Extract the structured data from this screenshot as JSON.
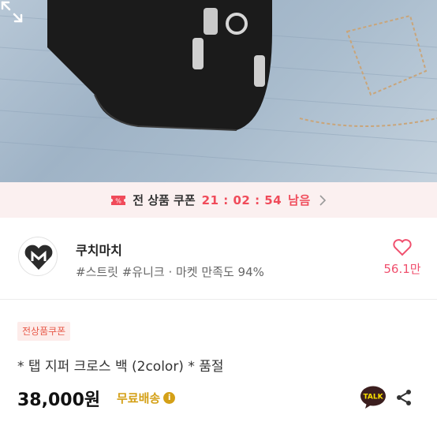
{
  "product_image": {
    "alt": "black crossbody bag on denim",
    "expand_icon": "expand-icon"
  },
  "coupon_banner": {
    "icon": "coupon-icon",
    "label": "전 상품 쿠폰",
    "timer": "21 : 02 : 54",
    "suffix": "남음",
    "arrow_icon": "chevron-right-icon"
  },
  "shop": {
    "name": "쿠치마치",
    "meta": "#스트릿 #유니크 · 마켓 만족도 94%",
    "like_icon": "heart-icon",
    "like_count": "56.1만"
  },
  "product": {
    "badge": "전상품쿠폰",
    "title": "* 탭 지퍼 크로스 백 (2color) * 품절",
    "price": "38,000원",
    "shipping": "무료배송",
    "shipping_info_icon": "info-icon",
    "info_glyph": "i",
    "talk_label": "TALK",
    "share_icon": "share-icon"
  },
  "colors": {
    "accent_red": "#f04b5a",
    "heart_pink": "#f0506e",
    "shipping_gold": "#d4a017",
    "coupon_bg": "#fbf0f0"
  }
}
